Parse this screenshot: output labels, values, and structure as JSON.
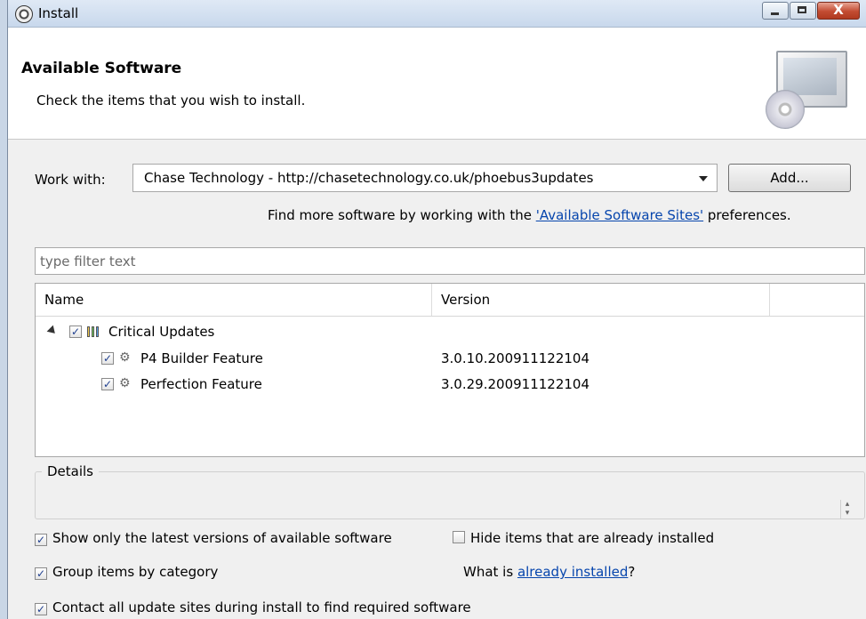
{
  "window": {
    "title": "Install",
    "buttons": {
      "minimize": "minimize",
      "maximize": "maximize",
      "close": "X"
    }
  },
  "banner": {
    "title": "Available Software",
    "subtitle": "Check the items that you wish to install.",
    "icon": "computer-cd-icon"
  },
  "work_with": {
    "label": "Work with:",
    "value": "Chase Technology - http://chasetechnology.co.uk/phoebus3updates",
    "add_button": "Add...",
    "find_more_prefix": "Find more software by working with the ",
    "find_more_link": "'Available Software Sites'",
    "find_more_suffix": " preferences."
  },
  "filter": {
    "placeholder": "type filter text",
    "value": ""
  },
  "table": {
    "columns": [
      "Name",
      "Version"
    ],
    "rows": [
      {
        "name": "Critical Updates",
        "version": "",
        "checked": true,
        "type": "category",
        "expanded": true
      },
      {
        "name": "P4 Builder Feature",
        "version": "3.0.10.200911122104",
        "checked": true,
        "type": "feature"
      },
      {
        "name": "Perfection Feature",
        "version": "3.0.29.200911122104",
        "checked": true,
        "type": "feature"
      }
    ]
  },
  "details": {
    "label": "Details"
  },
  "options": {
    "latest_only": {
      "label": "Show only the latest versions of available software",
      "checked": true
    },
    "hide_installed": {
      "label": "Hide items that are already installed",
      "checked": false
    },
    "group_by_category": {
      "label": "Group items by category",
      "checked": true
    },
    "what_is_prefix": "What is ",
    "what_is_link": "already installed",
    "what_is_suffix": "?",
    "contact_sites": {
      "label": "Contact all update sites during install to find required software",
      "checked": true
    }
  },
  "colors": {
    "link": "#0645ad",
    "titlebar": "#dfe9f5",
    "close_button": "#c24b31"
  }
}
